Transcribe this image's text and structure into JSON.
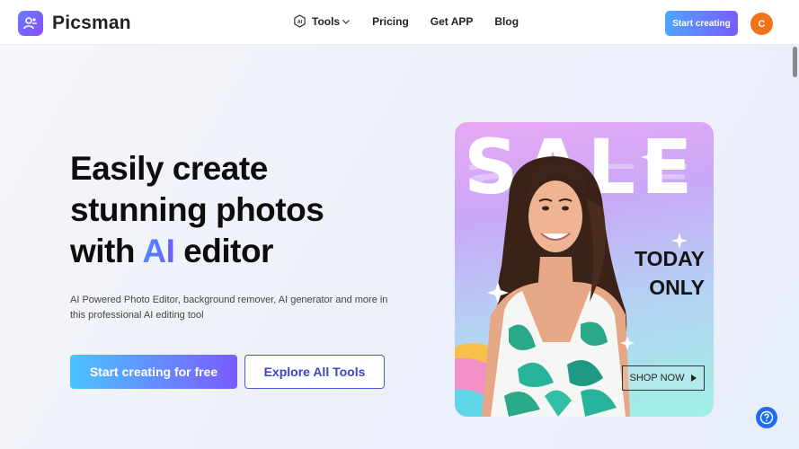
{
  "brand": {
    "name": "Picsman",
    "accent": "#7a5bff"
  },
  "nav": {
    "items": [
      {
        "label": "Tools",
        "icon": "ai-chip-icon",
        "has_dropdown": true
      },
      {
        "label": "Pricing"
      },
      {
        "label": "Get APP"
      },
      {
        "label": "Blog"
      }
    ],
    "cta_label": "Start creating",
    "avatar_letter": "C",
    "avatar_color": "#f0731b"
  },
  "hero": {
    "title_line1": "Easily create",
    "title_line2": "stunning photos",
    "title_line3_pre": "with ",
    "title_line3_highlight": "AI",
    "title_line3_post": " editor",
    "description": "AI Powered Photo Editor, background remover, AI generator and more in this professional AI editing tool",
    "primary_button": "Start creating for free",
    "secondary_button": "Explore All Tools"
  },
  "promo": {
    "sale_word": "SALE",
    "today_line1": "TODAY",
    "today_line2": "ONLY",
    "shop_label": "SHOP NOW"
  },
  "help_icon": "question-icon"
}
